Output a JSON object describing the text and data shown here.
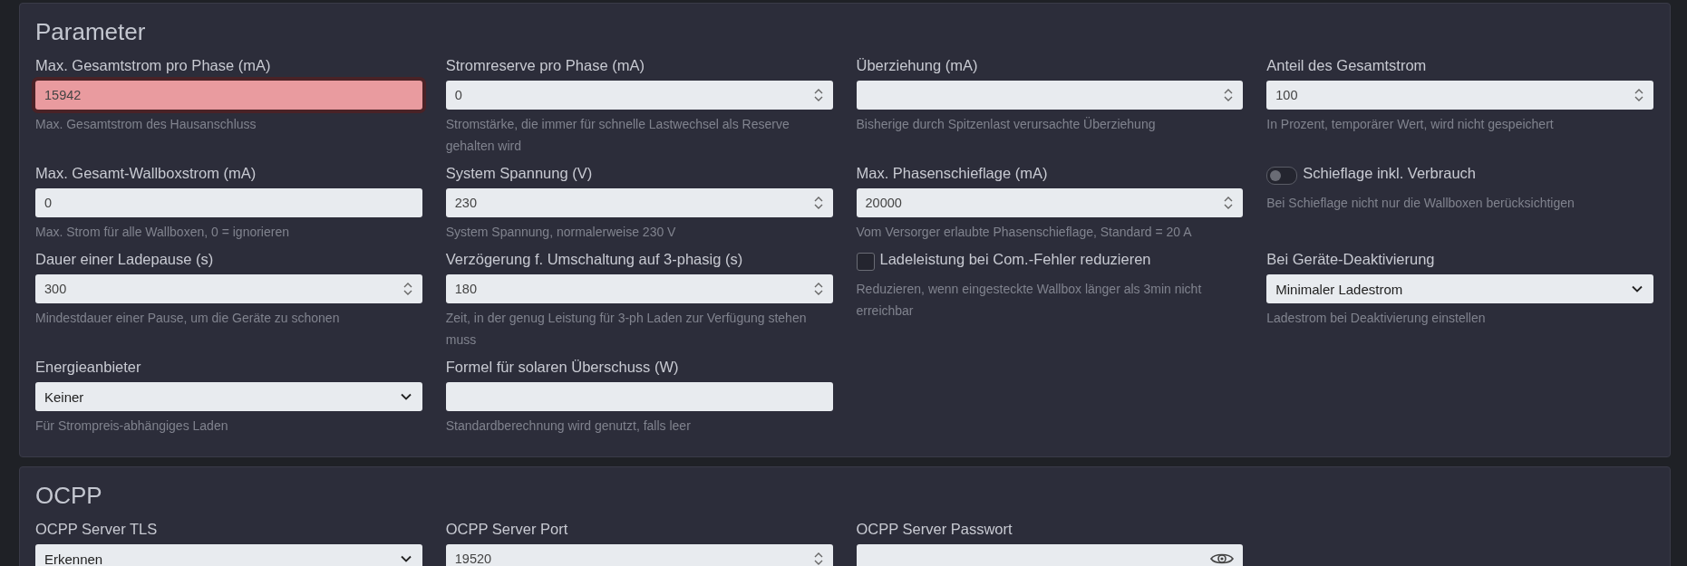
{
  "sections": [
    {
      "title": "Parameter",
      "fields": [
        {
          "kind": "number",
          "label": "Max. Gesamtstrom pro Phase (mA)",
          "value": "15942",
          "invalid": true,
          "help": "Max. Gesamtstrom des Hausanschluss"
        },
        {
          "kind": "number",
          "label": "Stromreserve pro Phase (mA)",
          "value": "0",
          "invalid": false,
          "help": "Stromstärke, die immer für schnelle Lastwechsel als Reserve gehalten wird"
        },
        {
          "kind": "number",
          "label": "Überziehung (mA)",
          "invalid": false,
          "help": "Bisherige durch Spitzenlast verursachte Überziehung"
        },
        {
          "kind": "number",
          "label": "Anteil des Gesamtstrom",
          "value": "100",
          "invalid": false,
          "help": "In Prozent, temporärer Wert, wird nicht gespeichert"
        },
        {
          "kind": "text",
          "label": "Max. Gesamt-Wallboxstrom (mA)",
          "value": "0",
          "invalid": false,
          "help": "Max. Strom für alle Wallboxen, 0 = ignorieren"
        },
        {
          "kind": "number",
          "label": "System Spannung (V)",
          "value": "230",
          "invalid": false,
          "help": "System Spannung, normalerweise 230 V"
        },
        {
          "kind": "number",
          "label": "Max. Phasenschieflage (mA)",
          "value": "20000",
          "invalid": false,
          "help": "Vom Versorger erlaubte Phasenschieflage, Standard = 20 A"
        },
        {
          "kind": "toggle",
          "label": "Schieflage inkl. Verbrauch",
          "on": false,
          "help": "Bei Schieflage nicht nur die Wallboxen berücksichtigen"
        },
        {
          "kind": "number",
          "label": "Dauer einer Ladepause (s)",
          "value": "300",
          "invalid": false,
          "help": "Mindestdauer einer Pause, um die Geräte zu schonen"
        },
        {
          "kind": "number",
          "label": "Verzögerung f. Umschaltung auf 3-phasig (s)",
          "value": "180",
          "invalid": false,
          "help": "Zeit, in der genug Leistung für 3-ph Laden zur Verfügung stehen muss"
        },
        {
          "kind": "checkbox",
          "label": "Ladeleistung bei Com.-Fehler reduzieren",
          "checked": false,
          "help": "Reduzieren, wenn eingesteckte Wallbox länger als 3min nicht erreichbar"
        },
        {
          "kind": "select",
          "label": "Bei Geräte-Deaktivierung",
          "value": "Minimaler Ladestrom",
          "help": "Ladestrom bei Deaktivierung einstellen"
        },
        {
          "kind": "select",
          "label": "Energieanbieter",
          "value": "Keiner",
          "help": "Für Strompreis-abhängiges Laden"
        },
        {
          "kind": "text",
          "label": "Formel für solaren Überschuss (W)",
          "invalid": false,
          "help": "Standardberechnung wird genutzt, falls leer"
        }
      ]
    },
    {
      "title": "OCPP",
      "fields": [
        {
          "kind": "select",
          "label": "OCPP Server TLS",
          "value": "Erkennen"
        },
        {
          "kind": "number",
          "label": "OCPP Server Port",
          "value": "19520",
          "invalid": false
        },
        {
          "kind": "password",
          "label": "OCPP Server Passwort",
          "invalid": false
        }
      ]
    }
  ]
}
